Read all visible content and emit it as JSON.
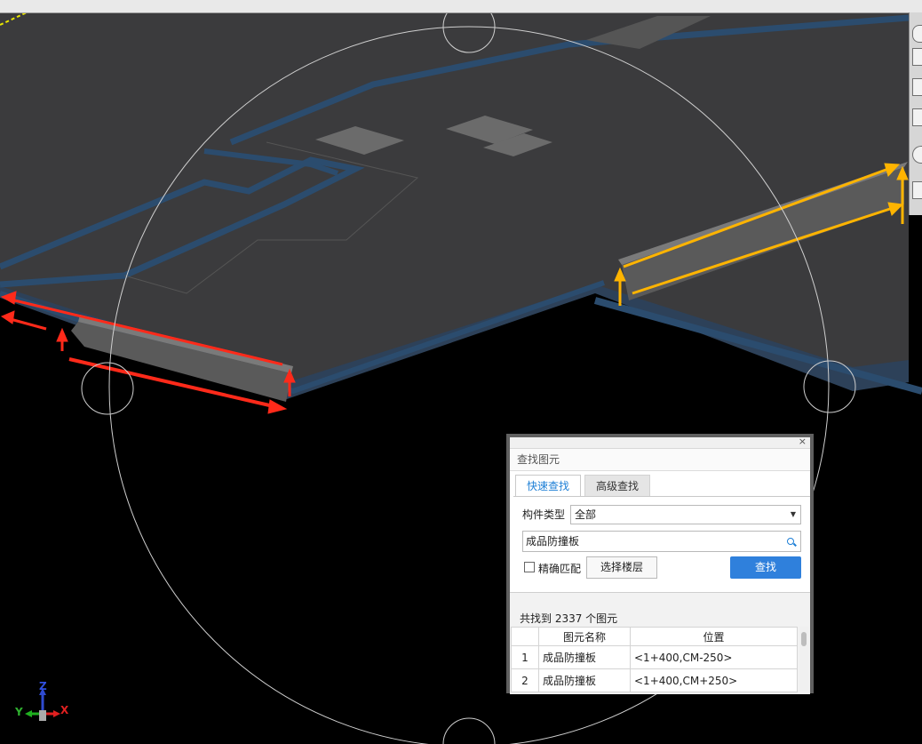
{
  "dialog": {
    "title": "查找图元",
    "close": "×",
    "tabs": [
      {
        "label": "快速查找",
        "active": true
      },
      {
        "label": "高级查找",
        "active": false
      }
    ],
    "type_label": "构件类型",
    "type_value": "全部",
    "search_value": "成品防撞板",
    "exact_match": {
      "label": "精确匹配",
      "checked": false
    },
    "select_floor_label": "选择楼层",
    "find_label": "查找",
    "result_count": "共找到 2337 个图元",
    "table": {
      "headers": [
        "图元名称",
        "位置"
      ],
      "rows": [
        {
          "num": "1",
          "name": "成品防撞板",
          "position": "<1+400,CM-250>"
        },
        {
          "num": "2",
          "name": "成品防撞板",
          "position": "<1+400,CM+250>"
        }
      ]
    }
  },
  "axes": {
    "x": "X",
    "y": "Y",
    "z": "Z"
  },
  "colors": {
    "slab": "#3b3b3d",
    "slab_edge": "#2b3e55",
    "arrow_red": "#ff2a1a",
    "arrow_yellow": "#ffb400",
    "accent": "#2f80dc"
  },
  "icons": [
    "search-icon",
    "dropdown-arrow-icon",
    "close-icon",
    "view-cube-icon",
    "axis-gizmo-icon"
  ]
}
